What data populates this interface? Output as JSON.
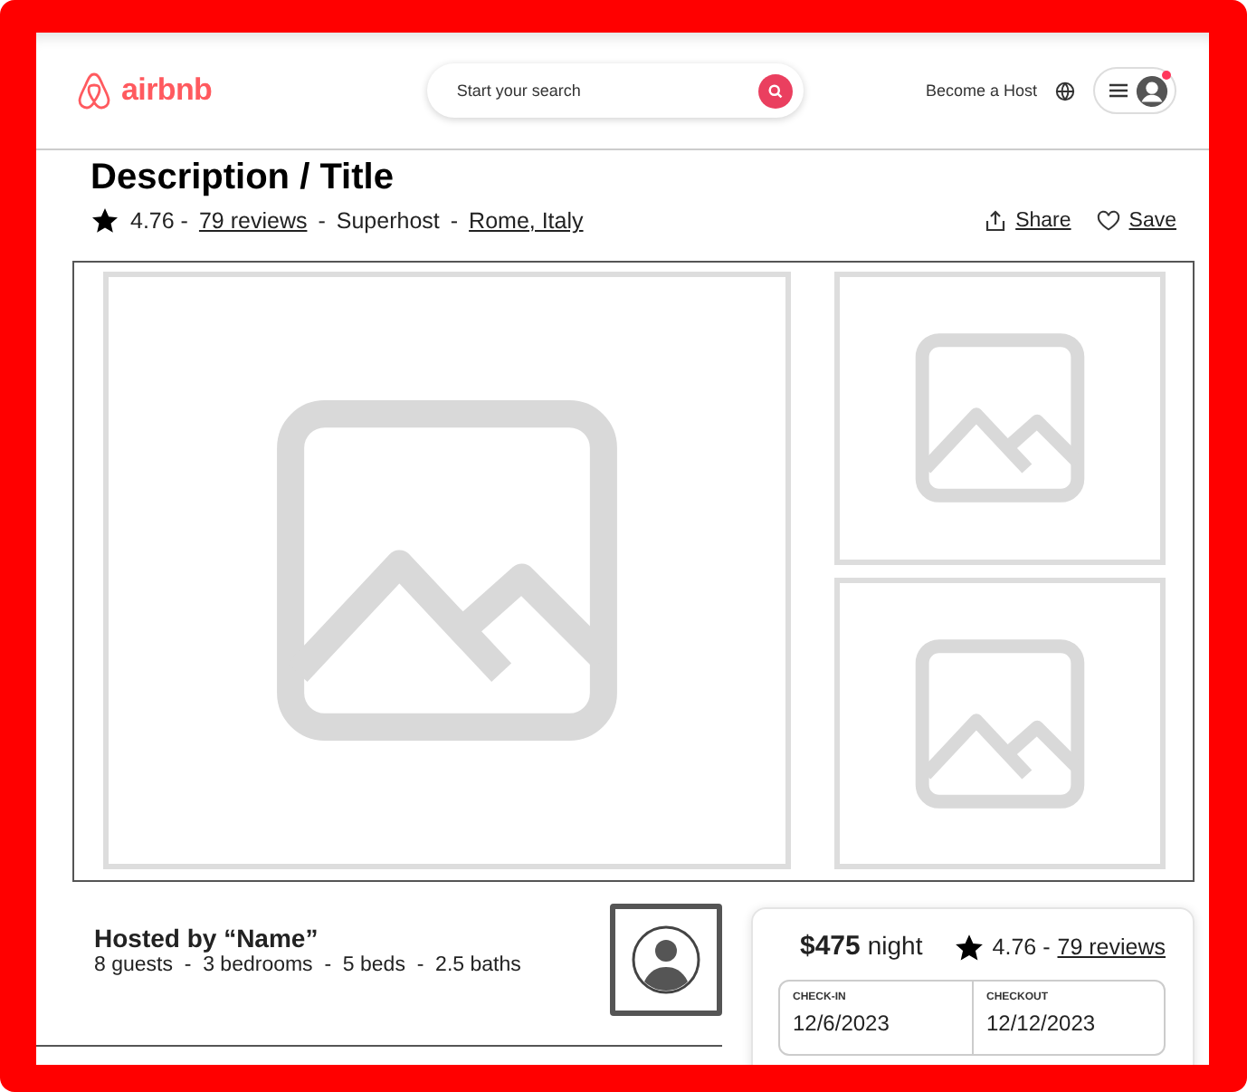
{
  "header": {
    "logo": "airbnb",
    "search": {
      "placeholder": "Start your search"
    },
    "host_link": "Become a Host",
    "notification": true
  },
  "listing": {
    "title": "Description / Title",
    "rating": "4.76 -",
    "reviews": "79 reviews",
    "separators": [
      "-",
      "-"
    ],
    "badge": "Superhost",
    "location": "Rome, Italy",
    "actions": [
      {
        "kind": "share",
        "label": "Share"
      },
      {
        "kind": "save",
        "label": "Save"
      }
    ]
  },
  "host": {
    "title": "Hosted by “Name”",
    "details": "8 guests  -  3 bedrooms  -  5 beds  -  2.5 baths"
  },
  "booking": {
    "price": "$475",
    "unit": "night",
    "rating": "4.76 -",
    "reviews": "79 reviews",
    "fields": [
      {
        "label": "CHECK-IN",
        "value": "12/6/2023"
      },
      {
        "label": "CHECKOUT",
        "value": "12/12/2023"
      }
    ]
  }
}
